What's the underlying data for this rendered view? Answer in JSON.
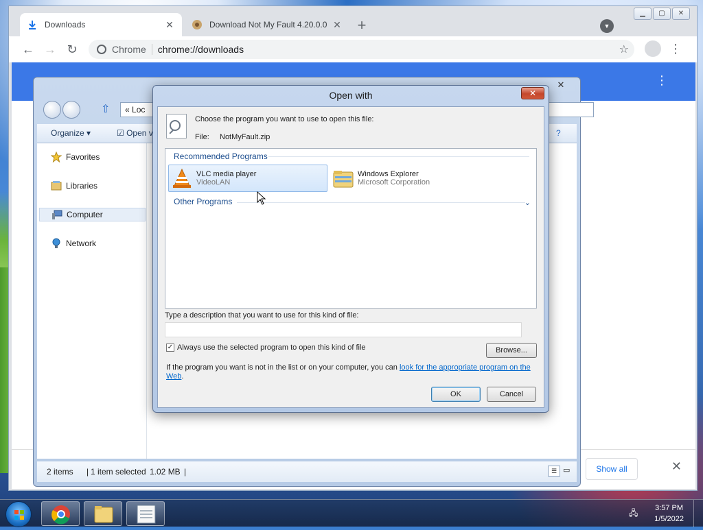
{
  "chrome": {
    "tabs": [
      {
        "title": "Downloads",
        "icon": "download-icon"
      },
      {
        "title": "Download Not My Fault 4.20.0.0",
        "icon": "app-icon"
      }
    ],
    "site_name": "Chrome",
    "url": "chrome://downloads",
    "show_all": "Show all"
  },
  "explorer": {
    "address_fragment": "Loc",
    "address_prefix": "«",
    "commands": {
      "organize": "Organize",
      "open": "Open v"
    },
    "nav": [
      "Favorites",
      "Libraries",
      "Computer",
      "Network"
    ],
    "status": {
      "items": "2 items",
      "selected": "1 item selected",
      "size": "1.02 MB"
    }
  },
  "dialog": {
    "title": "Open with",
    "prompt": "Choose the program you want to use to open this file:",
    "file_label": "File:",
    "file_name": "NotMyFault.zip",
    "recommended_label": "Recommended Programs",
    "programs": [
      {
        "name": "VLC media player",
        "vendor": "VideoLAN",
        "selected": true
      },
      {
        "name": "Windows Explorer",
        "vendor": "Microsoft Corporation",
        "selected": false
      }
    ],
    "other_label": "Other Programs",
    "description_label": "Type a description that you want to use for this kind of file:",
    "description_value": "",
    "always_use_label": "Always use the selected program to open this kind of file",
    "always_use_checked": true,
    "browse_label": "Browse...",
    "note_text": "If the program you want is not in the list or on your computer, you can ",
    "note_link": "look for the appropriate program on the Web",
    "note_end": ".",
    "ok_label": "OK",
    "cancel_label": "Cancel"
  },
  "taskbar": {
    "time": "3:57 PM",
    "date": "1/5/2022",
    "apps": [
      "chrome-icon",
      "explorer-folder-icon",
      "notepad-icon"
    ]
  }
}
